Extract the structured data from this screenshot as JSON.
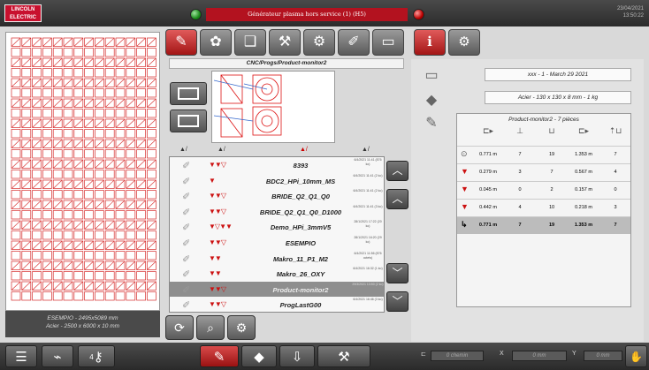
{
  "topbar": {
    "logo_line1": "LINCOLN",
    "logo_line2": "ELECTRIC",
    "alarm_text": "Générateur plasma hors service (1) (H5)",
    "date": "23/04/2021",
    "time": "13:50:22"
  },
  "preview": {
    "name_line": "ESEMPIO - 2495x5089 mm",
    "material_line": "Acier - 2500 x 6000 x 10 mm"
  },
  "center": {
    "path": "CNC/Progs/Product-monitor2",
    "toolbar_icons": [
      "folder-icon",
      "palette-icon",
      "folder-open-icon",
      "folder-tools-icon",
      "parts-icon",
      "edit-folder-icon",
      "monitor-icon"
    ],
    "nav_prev_icon": "arrow-left-icon",
    "nav_next_icon": "arrow-right-icon",
    "files": [
      {
        "name": "8393",
        "date": "6/4/2021 11:41 (876 ko)",
        "marks": "▼▼▽",
        "selected": false
      },
      {
        "name": "BDC2_HPi_10mm_MS",
        "date": "6/4/2021 11:41 (2 ko)",
        "marks": "▼",
        "selected": false
      },
      {
        "name": "BRIDE_Q2_Q1_Q0",
        "date": "6/4/2021 11:41 (2 ko)",
        "marks": "▼▼▽",
        "selected": false
      },
      {
        "name": "BRIDE_Q2_Q1_Q0_D1000",
        "date": "6/4/2021 11:41 (3 ko)",
        "marks": "▼▼▽",
        "selected": false
      },
      {
        "name": "Demo_HPi_3mmV5",
        "date": "28/1/2021 17:22 (20 ko)",
        "marks": "▼▽▼▼",
        "selected": false
      },
      {
        "name": "ESEMPIO",
        "date": "28/1/2021 16:20 (29 ko)",
        "marks": "▼▼▽",
        "selected": false
      },
      {
        "name": "Makro_11_P1_M2",
        "date": "6/4/2021 11:56 (876 octets)",
        "marks": "▼▼",
        "selected": false
      },
      {
        "name": "Makro_26_OXY",
        "date": "6/4/2021 16:32 (1 ko)",
        "marks": "▼▼",
        "selected": false
      },
      {
        "name": "Product-monitor2",
        "date": "29/3/2021 13:50 (2 ko)",
        "marks": "▼▼▽",
        "selected": true
      },
      {
        "name": "ProgLastG00",
        "date": "6/4/2021 16:46 (3 ko)",
        "marks": "▼▼▽",
        "selected": false
      }
    ]
  },
  "right": {
    "info_line1": "xxx - 1 - March 29 2021",
    "info_line2": "Acier - 130 x 130 x 8 mm - 1 kg",
    "table_title": "Product-monitor2 - 7 pièces",
    "rows": [
      {
        "c1": "0.771 m",
        "c2": "7",
        "c3": "19",
        "c4": "1.353 m",
        "c5": "7"
      },
      {
        "c1": "0.279 m",
        "c2": "3",
        "c3": "7",
        "c4": "0.567 m",
        "c5": "4"
      },
      {
        "c1": "0.045 m",
        "c2": "0",
        "c3": "2",
        "c4": "0.157 m",
        "c5": "0"
      },
      {
        "c1": "0.442 m",
        "c2": "4",
        "c3": "10",
        "c4": "0.218 m",
        "c5": "3"
      }
    ],
    "total": {
      "c1": "0.771 m",
      "c2": "7",
      "c3": "19",
      "c4": "1.353 m",
      "c5": "7"
    }
  },
  "bottombar": {
    "x_label": "X",
    "y_label": "Y",
    "path_value": "0 chemin",
    "x_value": "0 mm",
    "y_value": "0 mm",
    "usb_badge": "4"
  }
}
